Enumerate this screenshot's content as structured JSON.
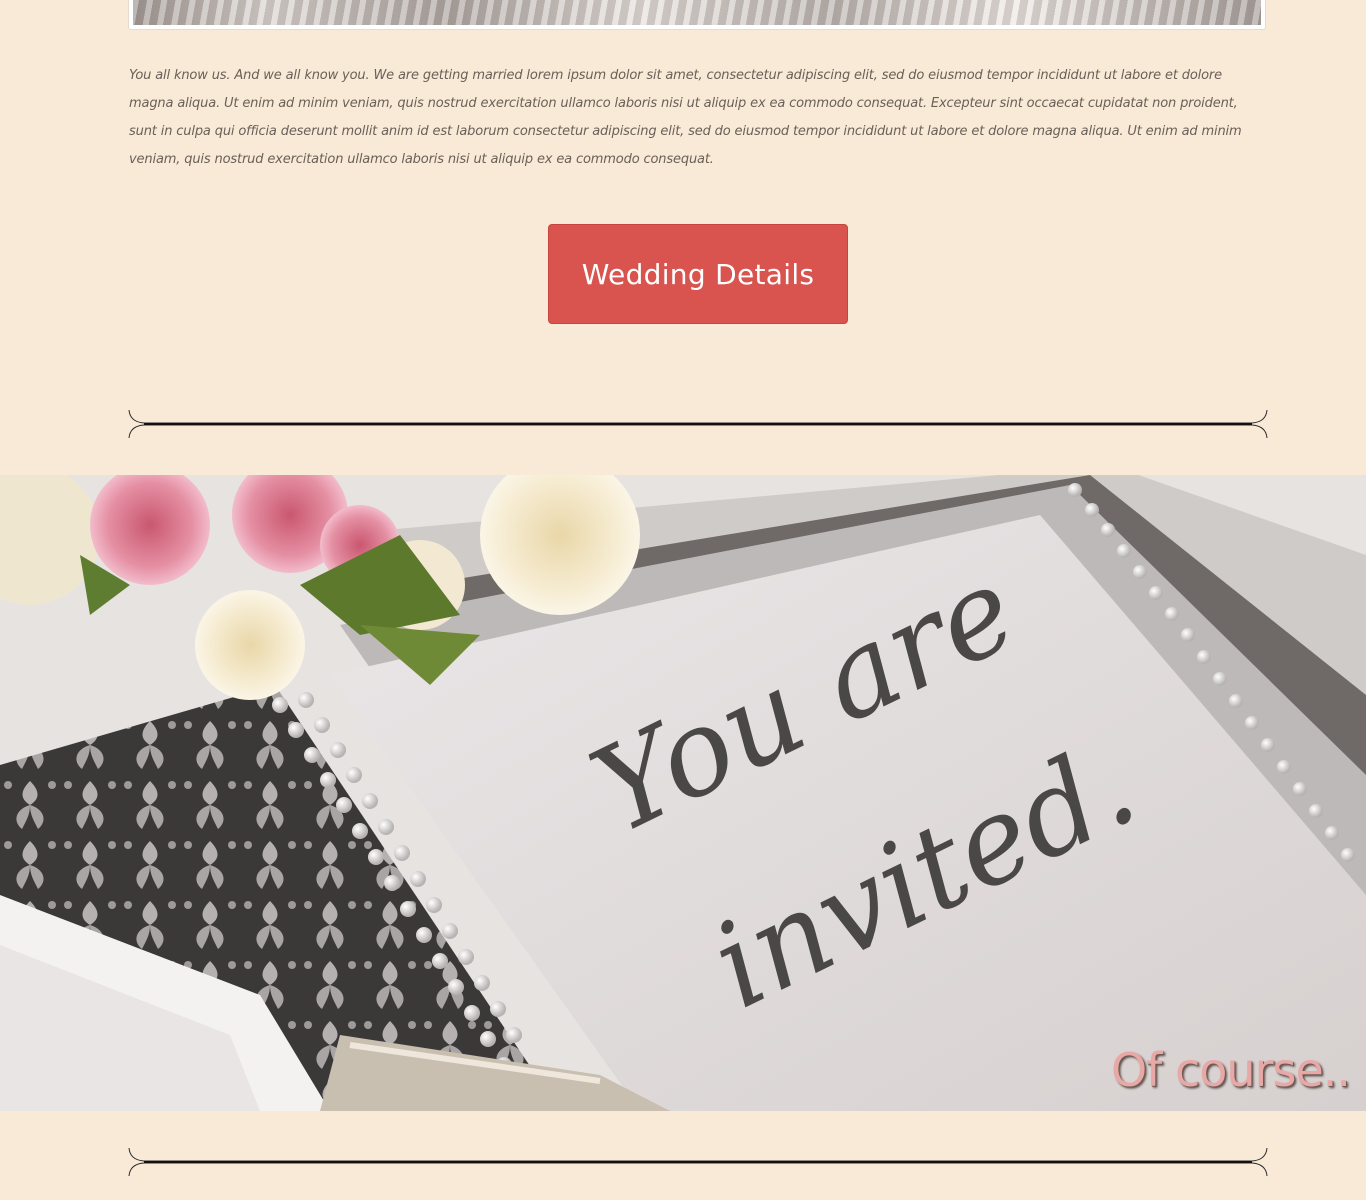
{
  "intro": {
    "text": "You all know us. And we all know you. We are getting married lorem ipsum dolor sit amet, consectetur adipiscing elit, sed do eiusmod tempor incididunt ut labore et dolore magna aliqua. Ut enim ad minim veniam, quis nostrud exercitation ullamco laboris nisi ut aliquip ex ea commodo consequat. Excepteur sint occaecat cupidatat non proident, sunt in culpa qui officia deserunt mollit anim id est laborum consectetur adipiscing elit, sed do eiusmod tempor incididunt ut labore et dolore magna aliqua. Ut enim ad minim veniam, quis nostrud exercitation ullamco laboris nisi ut aliquip ex ea commodo consequat."
  },
  "cta": {
    "label": "Wedding Details"
  },
  "hero": {
    "card_line1": "You are",
    "card_line2": "invited.",
    "tagline": "Of course.."
  },
  "colors": {
    "page_background": "#f9ead7",
    "button": "#d9534f",
    "tagline": "#e7a8a6",
    "card_script": "#4a4846"
  }
}
